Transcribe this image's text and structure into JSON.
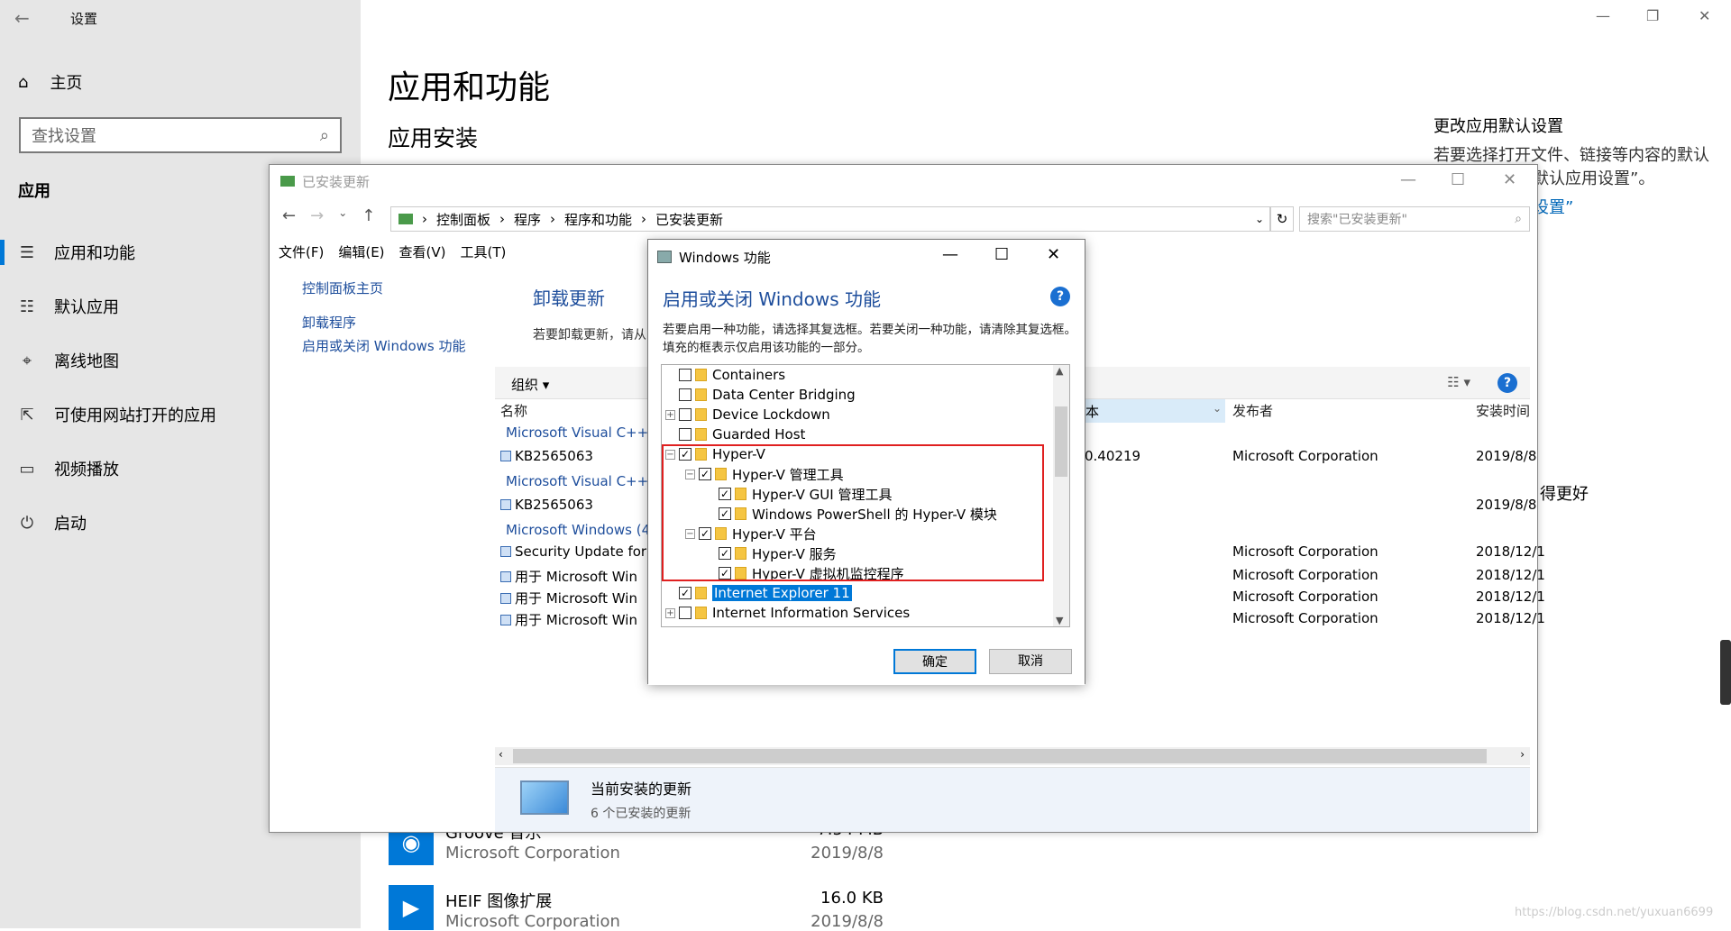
{
  "settings": {
    "window_title": "设置",
    "home": "主页",
    "search_placeholder": "查找设置",
    "section": "应用",
    "nav": [
      {
        "label": "应用和功能",
        "icon": "apps-list-icon"
      },
      {
        "label": "默认应用",
        "icon": "default-apps-icon"
      },
      {
        "label": "离线地图",
        "icon": "map-icon"
      },
      {
        "label": "可使用网站打开的应用",
        "icon": "open-web-icon"
      },
      {
        "label": "视频播放",
        "icon": "video-icon"
      },
      {
        "label": "启动",
        "icon": "startup-icon"
      }
    ],
    "page_title": "应用和功能",
    "subtitle": "应用安装",
    "right_heading": "更改应用默认设置",
    "right_text_line1": "若要选择打开文件、链接等内容的默认",
    "right_text_line2": "默认应用设置”。",
    "right_link": "设置”",
    "right_better": "得更好",
    "apps": [
      {
        "name": "Groove 音乐",
        "publisher": "Microsoft Corporation",
        "size": "7.54 MB",
        "date": "2019/8/8"
      },
      {
        "name": "HEIF 图像扩展",
        "publisher": "Microsoft Corporation",
        "size": "16.0 KB",
        "date": "2019/8/8"
      }
    ],
    "watermark": "https://blog.csdn.net/yuxuan6699"
  },
  "updates_window": {
    "title": "已安装更新",
    "breadcrumb": [
      "控制面板",
      "程序",
      "程序和功能",
      "已安装更新"
    ],
    "search_placeholder": "搜索\"已安装更新\"",
    "menu": [
      "文件(F)",
      "编辑(E)",
      "查看(V)",
      "工具(T)"
    ],
    "links": [
      "控制面板主页",
      "卸载程序",
      "启用或关闭 Windows 功能"
    ],
    "heading": "卸载更新",
    "desc": "若要卸载更新，请从",
    "organize": "组织 ▾",
    "columns": {
      "name": "名称",
      "version": "本",
      "publisher": "发布者",
      "installed": "安装时间"
    },
    "rows": [
      {
        "name": "Microsoft Visual C++",
        "group": true
      },
      {
        "name": "KB2565063",
        "version": "0.40219",
        "publisher": "Microsoft Corporation",
        "date": "2019/8/8"
      },
      {
        "name": "Microsoft Visual C++",
        "group": true
      },
      {
        "name": "KB2565063",
        "version": "",
        "publisher": "",
        "date": "2019/8/8"
      },
      {
        "name": "Microsoft Windows (4",
        "group": true
      },
      {
        "name": "Security Update for",
        "publisher": "Microsoft Corporation",
        "date": "2018/12/1"
      },
      {
        "name": "用于 Microsoft Win",
        "publisher": "Microsoft Corporation",
        "date": "2018/12/1"
      },
      {
        "name": "用于 Microsoft Win",
        "publisher": "Microsoft Corporation",
        "date": "2018/12/1"
      },
      {
        "name": "用于 Microsoft Win",
        "publisher": "Microsoft Corporation",
        "date": "2018/12/1"
      }
    ],
    "status_title": "当前安装的更新",
    "status_count": "6 个已安装的更新"
  },
  "features_dialog": {
    "title": "Windows 功能",
    "heading": "启用或关闭 Windows 功能",
    "desc": "若要启用一种功能，请选择其复选框。若要关闭一种功能，请清除其复选框。填充的框表示仅启用该功能的一部分。",
    "items": [
      {
        "label": "Containers",
        "checked": false,
        "level": 0,
        "expand": ""
      },
      {
        "label": "Data Center Bridging",
        "checked": false,
        "level": 0,
        "expand": ""
      },
      {
        "label": "Device Lockdown",
        "checked": false,
        "level": 0,
        "expand": "+"
      },
      {
        "label": "Guarded Host",
        "checked": false,
        "level": 0,
        "expand": ""
      },
      {
        "label": "Hyper-V",
        "checked": true,
        "level": 0,
        "expand": "-"
      },
      {
        "label": "Hyper-V 管理工具",
        "checked": true,
        "level": 1,
        "expand": "-"
      },
      {
        "label": "Hyper-V GUI 管理工具",
        "checked": true,
        "level": 2,
        "expand": ""
      },
      {
        "label": "Windows PowerShell 的 Hyper-V 模块",
        "checked": true,
        "level": 2,
        "expand": ""
      },
      {
        "label": "Hyper-V 平台",
        "checked": true,
        "level": 1,
        "expand": "-"
      },
      {
        "label": "Hyper-V 服务",
        "checked": true,
        "level": 2,
        "expand": ""
      },
      {
        "label": "Hyper-V 虚拟机监控程序",
        "checked": true,
        "level": 2,
        "expand": ""
      },
      {
        "label": "Internet Explorer 11",
        "checked": true,
        "level": 0,
        "expand": "",
        "selected": true
      },
      {
        "label": "Internet Information Services",
        "checked": false,
        "level": 0,
        "expand": "+"
      }
    ],
    "ok": "确定",
    "cancel": "取消"
  }
}
